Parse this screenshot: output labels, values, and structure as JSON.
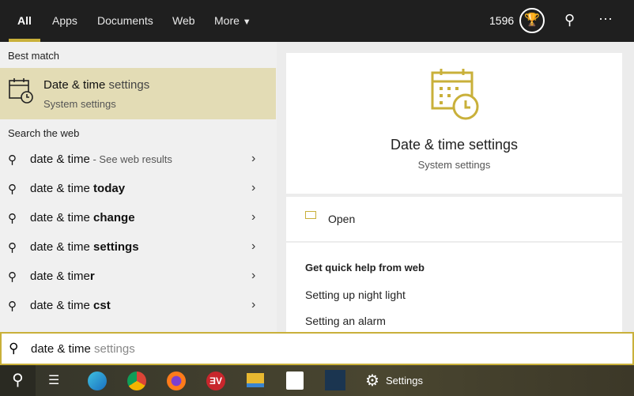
{
  "tabs": [
    {
      "label": "All"
    },
    {
      "label": "Apps"
    },
    {
      "label": "Documents"
    },
    {
      "label": "Web"
    },
    {
      "label": "More"
    }
  ],
  "header": {
    "points": "1596",
    "icons": [
      "trophy-icon",
      "feedback-icon",
      "more-icon"
    ]
  },
  "best_match": {
    "heading": "Best match",
    "title_bold": "Date & time",
    "title_rest": " settings",
    "subtitle": "System settings"
  },
  "web": {
    "heading": "Search the web",
    "items": [
      {
        "base": "date & time",
        "suffix": " - See web results",
        "bold": ""
      },
      {
        "base": "date & time ",
        "bold": "today"
      },
      {
        "base": "date & time ",
        "bold": "change"
      },
      {
        "base": "date & time ",
        "bold": "settings"
      },
      {
        "base": "date & time",
        "bold": "r"
      },
      {
        "base": "date & time ",
        "bold": "cst"
      }
    ]
  },
  "preview": {
    "title": "Date & time settings",
    "subtitle": "System settings",
    "open_label": "Open",
    "help_heading": "Get quick help from web",
    "help_links": [
      "Setting up night light",
      "Setting an alarm"
    ]
  },
  "search": {
    "typed": "date & time",
    "completion": " settings"
  },
  "taskbar": {
    "settings_label": "Settings"
  },
  "colors": {
    "accent": "#c9b03a",
    "highlight": "#e3dcb5"
  }
}
